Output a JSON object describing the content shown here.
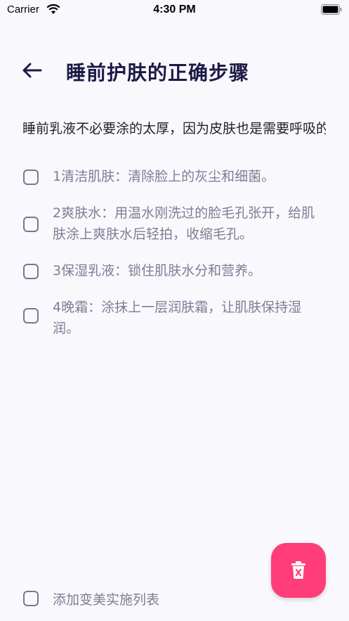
{
  "status_bar": {
    "carrier": "Carrier",
    "time": "4:30 PM"
  },
  "header": {
    "title": "睡前护肤的正确步骤"
  },
  "intro": "睡前乳液不必要涂的太厚，因为皮肤也是需要呼吸的",
  "steps": [
    {
      "text": "1清洁肌肤：清除脸上的灰尘和细菌。",
      "checked": false
    },
    {
      "text": "2爽肤水：用温水刚洗过的脸毛孔张开，给肌肤涂上爽肤水后轻拍，收缩毛孔。",
      "checked": false
    },
    {
      "text": "3保湿乳液：锁住肌肤水分和营养。",
      "checked": false
    },
    {
      "text": "4晚霜：涂抹上一层润肤霜，让肌肤保持湿润。",
      "checked": false
    }
  ],
  "footer": {
    "label": "添加变美实施列表"
  },
  "colors": {
    "accent": "#ff3d7a",
    "title": "#1d1a46",
    "muted": "#807c96"
  }
}
